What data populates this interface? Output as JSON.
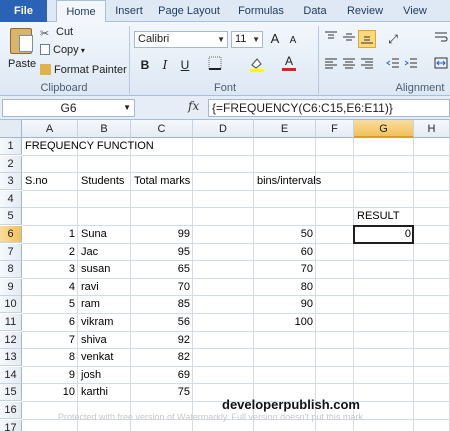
{
  "ribbon_tabs": [
    "File",
    "Home",
    "Insert",
    "Page Layout",
    "Formulas",
    "Data",
    "Review",
    "View"
  ],
  "clipboard": {
    "paste": "Paste",
    "cut": "Cut",
    "copy": "Copy",
    "format_painter": "Format Painter",
    "group_label": "Clipboard"
  },
  "font": {
    "name": "Calibri",
    "size": "11",
    "grow": "A",
    "shrink": "A",
    "bold": "B",
    "italic": "I",
    "underline": "U",
    "font_color_glyph": "A",
    "group_label": "Font"
  },
  "alignment": {
    "group_label": "Alignment"
  },
  "formula_bar": {
    "name_box": "G6",
    "fx": "fx",
    "formula": "{=FREQUENCY(C6:C15,E6:E11)}"
  },
  "grid": {
    "columns": [
      "A",
      "B",
      "C",
      "D",
      "E",
      "F",
      "G",
      "H"
    ],
    "rows": [
      "1",
      "2",
      "3",
      "4",
      "5",
      "6",
      "7",
      "8",
      "9",
      "10",
      "11",
      "12",
      "13",
      "14",
      "15",
      "16",
      "17"
    ],
    "cells": {
      "A1": "FREQUENCY FUNCTION",
      "A3": "S.no",
      "B3": "Students",
      "C3": "Total marks",
      "E3": "bins/intervals",
      "G5": "RESULT",
      "A6": "1",
      "B6": "Suna",
      "C6": "99",
      "E6": "50",
      "G6": "0",
      "A7": "2",
      "B7": "Jac",
      "C7": "95",
      "E7": "60",
      "A8": "3",
      "B8": "susan",
      "C8": "65",
      "E8": "70",
      "A9": "4",
      "B9": "ravi",
      "C9": "70",
      "E9": "80",
      "A10": "5",
      "B10": "ram",
      "C10": "85",
      "E10": "90",
      "A11": "6",
      "B11": "vikram",
      "C11": "56",
      "E11": "100",
      "A12": "7",
      "B12": "shiva",
      "C12": "92",
      "A13": "8",
      "B13": "venkat",
      "C13": "82",
      "A14": "9",
      "B14": "josh",
      "C14": "69",
      "A15": "10",
      "B15": "karthi",
      "C15": "75"
    }
  },
  "watermark": "developerpublish.com",
  "watermark_faint": "Protected with free version of Watermarkly. Full version doesn't put this mark.",
  "colors": {
    "file_tab": "#2a62b5",
    "selected_header": "#f2c25b",
    "ribbon": "#dde8f4"
  }
}
